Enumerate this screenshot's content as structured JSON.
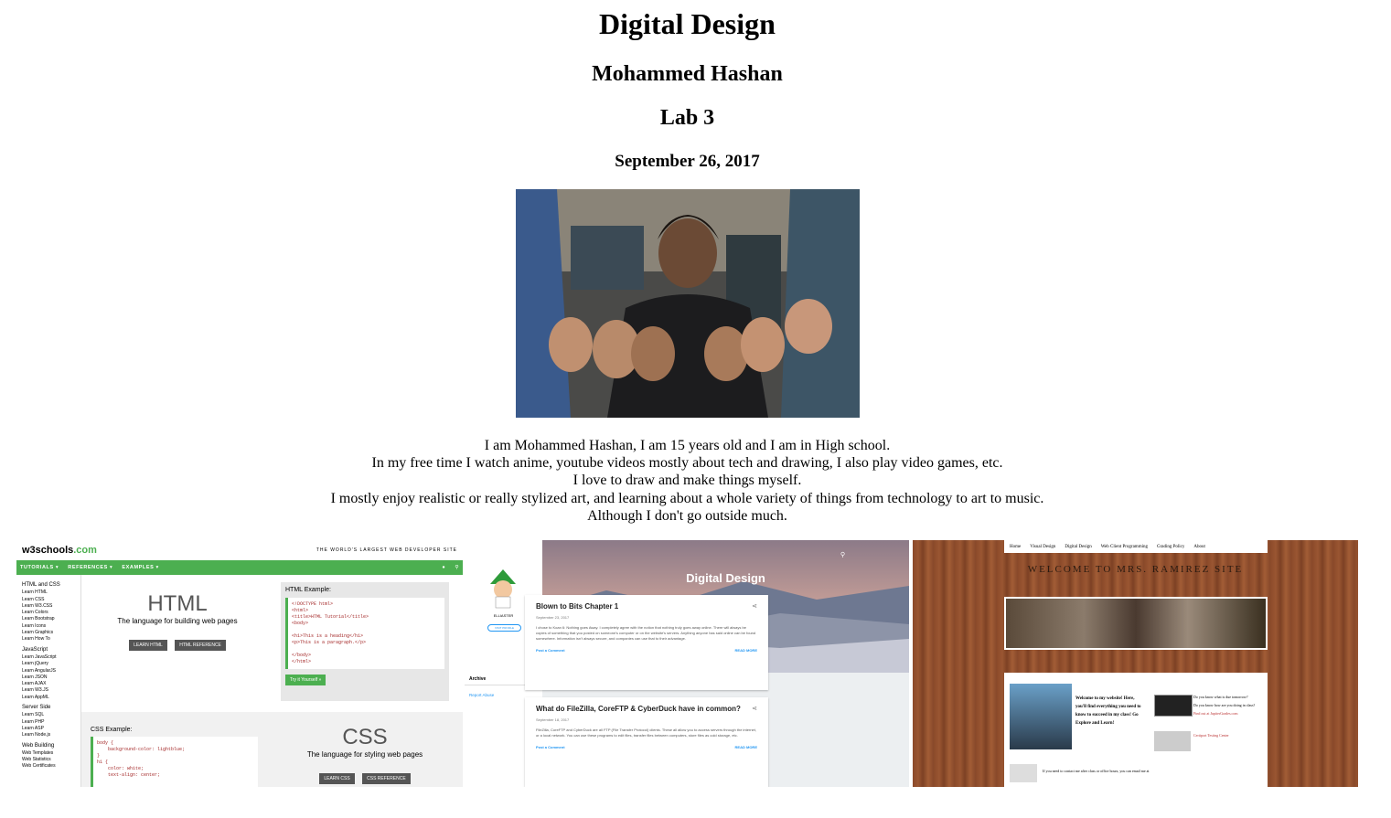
{
  "page": {
    "title": "Digital Design",
    "author": "Mohammed Hashan",
    "lab": "Lab 3",
    "date": "September 26, 2017"
  },
  "bio": [
    "I am Mohammed Hashan, I am 15 years old and I am in High school.",
    "In my free time I watch anime, youtube videos mostly about tech and drawing, I also play video games, etc.",
    "I love to draw and make things myself.",
    "I mostly enjoy realistic or really stylized art, and learning about a whole variety of things from technology to art to music.",
    "Although I don't go outside much."
  ],
  "w3": {
    "logo_a": "w3schools",
    "logo_b": ".com",
    "tagline": "THE WORLD'S LARGEST WEB DEVELOPER SITE",
    "nav": [
      "TUTORIALS ▾",
      "REFERENCES ▾",
      "EXAMPLES ▾"
    ],
    "side_sections": [
      {
        "title": "HTML and CSS",
        "items": [
          "Learn HTML",
          "Learn CSS",
          "Learn W3.CSS",
          "Learn Colors",
          "Learn Bootstrap",
          "Learn Icons",
          "Learn Graphics",
          "Learn How To"
        ]
      },
      {
        "title": "JavaScript",
        "items": [
          "Learn JavaScript",
          "Learn jQuery",
          "Learn AngularJS",
          "Learn JSON",
          "Learn AJAX",
          "Learn W3.JS",
          "Learn AppML"
        ]
      },
      {
        "title": "Server Side",
        "items": [
          "Learn SQL",
          "Learn PHP",
          "Learn ASP",
          "Learn Node.js"
        ]
      },
      {
        "title": "Web Building",
        "items": [
          "Web Templates",
          "Web Statistics",
          "Web Certificates"
        ]
      }
    ],
    "html_big": "HTML",
    "html_sub": "The language for building web pages",
    "html_btn1": "LEARN HTML",
    "html_btn2": "HTML REFERENCE",
    "html_example": "HTML Example:",
    "html_code": "<!DOCTYPE html>\n<html>\n<title>HTML Tutorial</title>\n<body>\n\n<h1>This is a heading</h1>\n<p>This is a paragraph.</p>\n\n</body>\n</html>",
    "try_btn": "Try it Yourself »",
    "css_example": "CSS Example:",
    "css_code": "body {\n    background-color: lightblue;\n}\nh1 {\n    color: white;\n    text-align: center;",
    "css_big": "CSS",
    "css_sub": "The language for styling web pages",
    "css_btn1": "LEARN CSS",
    "css_btn2": "CSS REFERENCE"
  },
  "blog": {
    "profile_name": "ELLIASTER",
    "profile_btn": "VISIT PROFILE",
    "archive": "Archive",
    "report": "Report Abuse",
    "hero_title": "Digital Design",
    "post1_title": "Blown to Bits Chapter 1",
    "post1_date": "September 23, 2017",
    "post1_text": "I chose to Koan 6: Nothing goes Away. I completely agree with the notion that nothing truly goes away online. There will always be copies of something that you posted on someone's computer or on the website's servers. Anything anyone has said online can be found somewhere. Information isn't always secure, and companies can use that to their advantage.",
    "post2_title": "What do FileZilla, CoreFTP & CyberDuck have in common?",
    "post2_date": "September 18, 2017",
    "post2_text": "FileZilla, CoreFTP and CyberDuck are all FTP (File Transfer Protocol) clients. These all allow you to access servers through the internet, or a local network. You can use these programs to edit files, transfer files between computers, store files as cold storage, etc.",
    "comment": "Post a Comment",
    "read_more": "READ MORE"
  },
  "ramirez": {
    "nav": [
      "Home",
      "Visual Design",
      "Digital Design",
      "Web Client Programming",
      "Grading Policy",
      "About"
    ],
    "title": "WELCOME TO MRS. RAMIREZ SITE",
    "welcome": "Welcome to my website! Here, you'll find everything you need to know to succeed in my class! Go Explore and Learn!",
    "q1": "Do you know what is due tomorrow?",
    "q2": "Do you know how are you doing in class?",
    "find": "Find out at JupiterGrades.com",
    "cert": "Certiport Testing Center",
    "contact": "If you need to contact me after class or office hours, you can email me at"
  }
}
